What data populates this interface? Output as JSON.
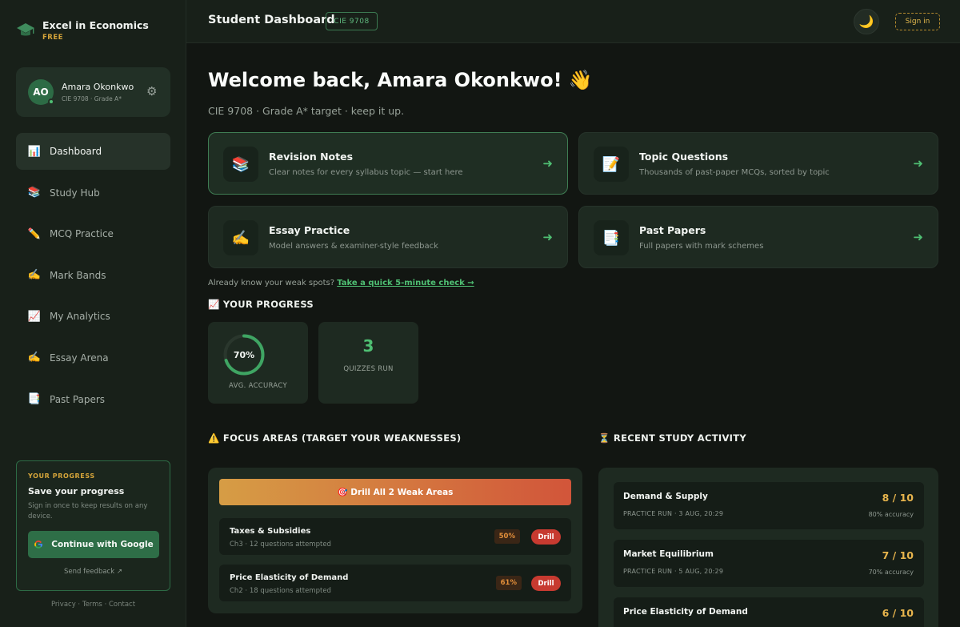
{
  "brand": {
    "name": "Excel in Economics",
    "tier": "FREE"
  },
  "profile": {
    "initials": "AO",
    "name": "Amara Okonkwo",
    "meta": "CIE 9708 · Grade A*"
  },
  "nav": [
    {
      "label": "Dashboard",
      "icon": "bar-chart-icon",
      "glyph": "📊"
    },
    {
      "label": "Study Hub",
      "icon": "books-icon",
      "glyph": "📚"
    },
    {
      "label": "MCQ Practice",
      "icon": "pencil-icon",
      "glyph": "✏️"
    },
    {
      "label": "Mark Bands",
      "icon": "writing-hand-icon",
      "glyph": "✍️"
    },
    {
      "label": "My Analytics",
      "icon": "line-chart-icon",
      "glyph": "📈"
    },
    {
      "label": "Essay Arena",
      "icon": "writing-hand-icon",
      "glyph": "✍️"
    },
    {
      "label": "Past Papers",
      "icon": "document-icon",
      "glyph": "📑"
    }
  ],
  "save_card": {
    "kicker": "YOUR PROGRESS",
    "title": "Save your progress",
    "desc": "Sign in once to keep results on any device.",
    "google_label": "Continue with Google",
    "feedback": "Send feedback ↗"
  },
  "footer": "Privacy · Terms · Contact",
  "topbar": {
    "title": "Student Dashboard",
    "course": "CIE 9708",
    "theme_glyph": "🌙",
    "signin": "Sign in"
  },
  "welcome": {
    "title": "Welcome back, Amara Okonkwo! 👋",
    "subtitle": "CIE 9708 · Grade A* target · keep it up."
  },
  "quick_cards": [
    {
      "title": "Revision Notes",
      "desc": "Clear notes for every syllabus topic — start here",
      "glyph": "📚",
      "icon": "books-icon"
    },
    {
      "title": "Topic Questions",
      "desc": "Thousands of past-paper MCQs, sorted by topic",
      "glyph": "📝",
      "icon": "memo-icon"
    },
    {
      "title": "Essay Practice",
      "desc": "Model answers & examiner-style feedback",
      "glyph": "✍️",
      "icon": "writing-hand-icon"
    },
    {
      "title": "Past Papers",
      "desc": "Full papers with mark schemes",
      "glyph": "📑",
      "icon": "document-icon"
    }
  ],
  "weak_check": {
    "prefix": "Already know your weak spots? ",
    "link": "Take a quick 5-minute check →"
  },
  "progress": {
    "title": "📈 YOUR PROGRESS",
    "accuracy_label": "70%",
    "accuracy_value": 0.7,
    "accuracy_caption": "AVG. ACCURACY",
    "quizzes_value": "3",
    "quizzes_caption": "QUIZZES RUN"
  },
  "focus": {
    "title": "⚠️ FOCUS AREAS (TARGET YOUR WEAKNESSES)",
    "drill_all": "🎯 Drill All 2 Weak Areas",
    "items": [
      {
        "name": "Taxes & Subsidies",
        "meta": "Ch3 · 12 questions attempted",
        "pct": "50%",
        "drill": "Drill"
      },
      {
        "name": "Price Elasticity of Demand",
        "meta": "Ch2 · 18 questions attempted",
        "pct": "61%",
        "drill": "Drill"
      }
    ]
  },
  "activity": {
    "title": "⏳ RECENT STUDY ACTIVITY",
    "items": [
      {
        "name": "Demand & Supply",
        "meta": "PRACTICE RUN · 3 AUG, 20:29",
        "score": "8 / 10",
        "acc": "80% accuracy"
      },
      {
        "name": "Market Equilibrium",
        "meta": "PRACTICE RUN · 5 AUG, 20:29",
        "score": "7 / 10",
        "acc": "70% accuracy"
      },
      {
        "name": "Price Elasticity of Demand",
        "meta": "",
        "score": "6 / 10",
        "acc": ""
      }
    ]
  },
  "colors": {
    "accent": "#4fbf73",
    "brand_green": "#2e6e47",
    "gold": "#e8b54d",
    "danger": "#c73a30"
  }
}
